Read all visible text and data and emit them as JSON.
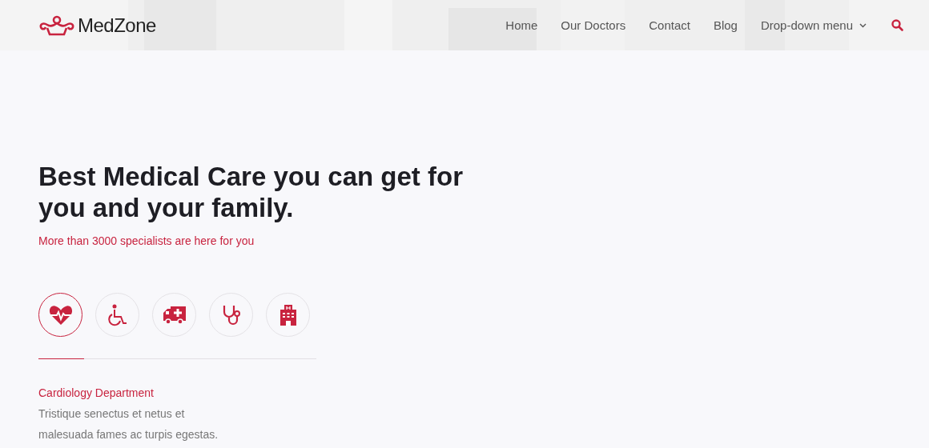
{
  "header": {
    "logo": "MedZone",
    "nav": [
      {
        "label": "Home"
      },
      {
        "label": "Our Doctors"
      },
      {
        "label": "Contact"
      },
      {
        "label": "Blog"
      },
      {
        "label": "Drop-down menu",
        "dropdown": true
      }
    ]
  },
  "hero": {
    "title": "Best Medical Care you can get for you and your family.",
    "subtitle": "More than 3000 specialists are here for you"
  },
  "services": [
    {
      "selected": true
    },
    {
      "selected": false
    },
    {
      "selected": false
    },
    {
      "selected": false
    },
    {
      "selected": false
    }
  ],
  "department": {
    "title": "Cardiology Department",
    "text": "Tristique senectus et netus et malesuada fames ac turpis egestas."
  }
}
